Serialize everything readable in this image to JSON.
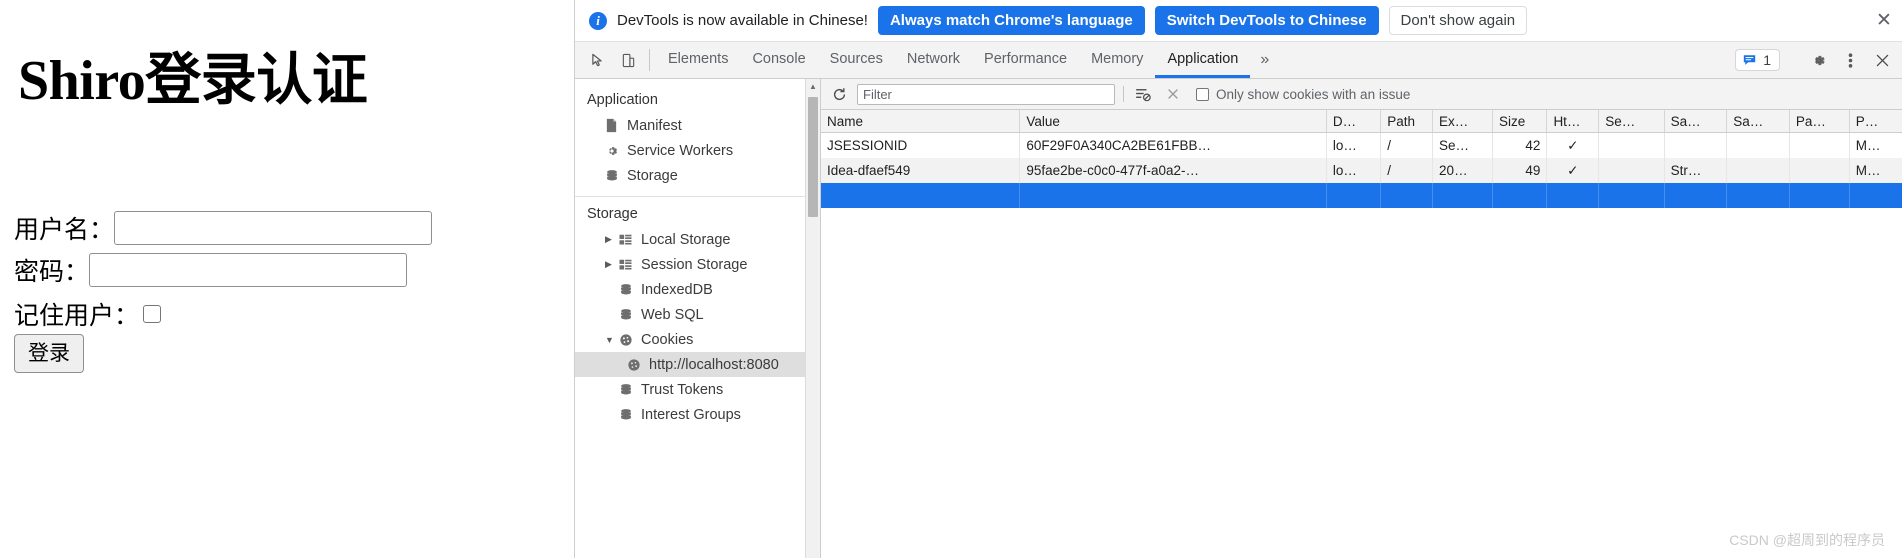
{
  "page": {
    "title": "Shiro登录认证",
    "form": {
      "username_label": "用户名：",
      "username_value": "",
      "password_label": "密码：",
      "password_value": "",
      "remember_label": "记住用户：",
      "remember_checked": false,
      "submit_label": "登录"
    }
  },
  "devtools": {
    "banner": {
      "icon": "info-icon",
      "message": "DevTools is now available in Chinese!",
      "primary_button": "Always match Chrome's language",
      "secondary_button": "Switch DevTools to Chinese",
      "dismiss_button": "Don't show again",
      "close_icon": "close-icon",
      "accent_color": "#1a73e8"
    },
    "toolbar": {
      "inspect_icon": "inspect-element-icon",
      "device_icon": "device-toolbar-icon",
      "tabs": [
        {
          "label": "Elements",
          "active": false
        },
        {
          "label": "Console",
          "active": false
        },
        {
          "label": "Sources",
          "active": false
        },
        {
          "label": "Network",
          "active": false
        },
        {
          "label": "Performance",
          "active": false
        },
        {
          "label": "Memory",
          "active": false
        },
        {
          "label": "Application",
          "active": true
        }
      ],
      "more_tabs_icon": "chevron-double-right-icon",
      "issues_icon": "issues-message-icon",
      "issues_count": "1",
      "settings_icon": "gear-icon",
      "menu_icon": "kebab-menu-icon",
      "close_icon": "close-icon",
      "active_tab_underline_color": "#1a73e8"
    },
    "sidebar": {
      "application_header": "Application",
      "application_items": [
        {
          "label": "Manifest",
          "icon": "manifest-document-icon"
        },
        {
          "label": "Service Workers",
          "icon": "gear-icon"
        },
        {
          "label": "Storage",
          "icon": "database-icon"
        }
      ],
      "storage_header": "Storage",
      "storage_items": [
        {
          "label": "Local Storage",
          "icon": "table-grid-icon",
          "twisty": "collapsed"
        },
        {
          "label": "Session Storage",
          "icon": "table-grid-icon",
          "twisty": "collapsed"
        },
        {
          "label": "IndexedDB",
          "icon": "database-icon",
          "twisty": "none"
        },
        {
          "label": "Web SQL",
          "icon": "database-icon",
          "twisty": "none"
        },
        {
          "label": "Cookies",
          "icon": "cookie-icon",
          "twisty": "expanded"
        },
        {
          "label": "http://localhost:8080",
          "icon": "cookie-icon",
          "twisty": "none",
          "child": true,
          "selected": true
        },
        {
          "label": "Trust Tokens",
          "icon": "database-icon",
          "twisty": "none"
        },
        {
          "label": "Interest Groups",
          "icon": "database-icon",
          "twisty": "none"
        }
      ]
    },
    "cookies": {
      "refresh_icon": "refresh-icon",
      "filter_placeholder": "Filter",
      "filter_value": "",
      "clear_all_icon": "clear-all-cookies-icon",
      "delete_icon": "delete-cookie-icon",
      "issue_filter_label": "Only show cookies with an issue",
      "issue_filter_checked": false,
      "columns": [
        "Name",
        "Value",
        "D…",
        "Path",
        "Ex…",
        "Size",
        "Ht…",
        "Se…",
        "Sa…",
        "Sa…",
        "Pa…",
        "P…"
      ],
      "rows": [
        {
          "name": "JSESSIONID",
          "value": "60F29F0A340CA2BE61FBB…",
          "domain": "lo…",
          "path": "/",
          "expires": "Se…",
          "size": "42",
          "httponly": "✓",
          "secure": "",
          "samesite": "",
          "samepartykey": "",
          "partition": "",
          "priority": "M…",
          "selected": false
        },
        {
          "name": "Idea-dfaef549",
          "value": "95fae2be-c0c0-477f-a0a2-…",
          "domain": "lo…",
          "path": "/",
          "expires": "20…",
          "size": "49",
          "httponly": "✓",
          "secure": "",
          "samesite": "Str…",
          "samepartykey": "",
          "partition": "",
          "priority": "M…",
          "selected": false
        },
        {
          "name": "",
          "value": "",
          "domain": "",
          "path": "",
          "expires": "",
          "size": "",
          "httponly": "",
          "secure": "",
          "samesite": "",
          "samepartykey": "",
          "partition": "",
          "priority": "",
          "selected": true
        }
      ],
      "selection_color": "#1a73e8"
    },
    "watermark": "CSDN @超周到的程序员"
  }
}
